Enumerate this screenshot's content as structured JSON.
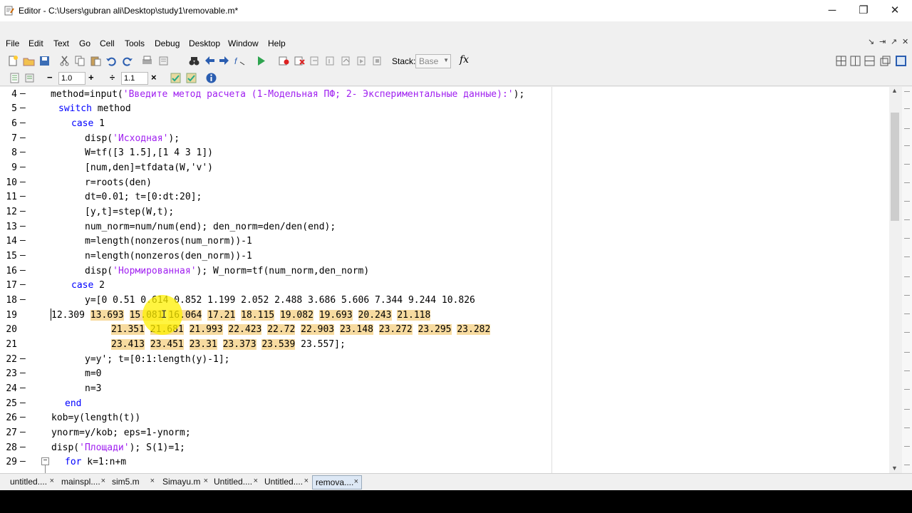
{
  "window": {
    "title": "Editor - C:\\Users\\gubran ali\\Desktop\\study1\\removable.m*",
    "minimize": "─",
    "restore": "❐",
    "close": "✕"
  },
  "menu": [
    "File",
    "Edit",
    "Text",
    "Go",
    "Cell",
    "Tools",
    "Debug",
    "Desktop",
    "Window",
    "Help"
  ],
  "menu_right": [
    "↘",
    "⇥",
    "↗",
    "✕"
  ],
  "toolbar": {
    "stack_label": "Stack:",
    "stack_value": "Base",
    "fx_label": "fx"
  },
  "cell_toolbar": {
    "minus": "−",
    "value1": "1.0",
    "plus": "+",
    "divide": "÷",
    "value2": "1.1",
    "times": "×"
  },
  "editor": {
    "lines": [
      {
        "n": "4",
        "dash": "–",
        "text": "method=input('Введите метод расчета (1-Модельная ПФ; 2- Экспериментальные данные):');"
      },
      {
        "n": "5",
        "dash": "–",
        "kw": "switch",
        "rest": " method"
      },
      {
        "n": "6",
        "dash": "–",
        "kw": "case",
        "rest": " 1"
      },
      {
        "n": "7",
        "dash": "–",
        "pre": "disp(",
        "str": "'Исходная'",
        "post": ");"
      },
      {
        "n": "8",
        "dash": "–",
        "text": "W=tf([3 1.5],[1 4 3 1])"
      },
      {
        "n": "9",
        "dash": "–",
        "text": "[num,den]=tfdata(W,'v')"
      },
      {
        "n": "10",
        "dash": "–",
        "text": "r=roots(den)"
      },
      {
        "n": "11",
        "dash": "–",
        "text": "dt=0.01; t=[0:dt:20];"
      },
      {
        "n": "12",
        "dash": "–",
        "text": "[y,t]=step(W,t);"
      },
      {
        "n": "13",
        "dash": "–",
        "text": "num_norm=num/num(end); den_norm=den/den(end);"
      },
      {
        "n": "14",
        "dash": "–",
        "text": "m=length(nonzeros(num_norm))-1"
      },
      {
        "n": "15",
        "dash": "–",
        "text": "n=length(nonzeros(den_norm))-1"
      },
      {
        "n": "16",
        "dash": "–",
        "pre": "disp(",
        "str": "'Нормированная'",
        "post": "); W_norm=tf(num_norm,den_norm)"
      },
      {
        "n": "17",
        "dash": "–",
        "kw": "case",
        "rest": " 2"
      },
      {
        "n": "18",
        "dash": "–",
        "text": "y=[0 0.51 0.614 0.852 1.199 2.052 2.488 3.686 5.606 7.344 9.244 10.826"
      },
      {
        "n": "19",
        "dash": "",
        "first": "12.309",
        "tokens": [
          "13.693",
          "15.081",
          "16.064",
          "17.21",
          "18.115",
          "19.082",
          "19.693",
          "20.243",
          "21.118"
        ]
      },
      {
        "n": "20",
        "dash": "",
        "tokens": [
          "21.351",
          "21.681",
          "21.993",
          "22.423",
          "22.72",
          "22.903",
          "23.148",
          "23.272",
          "23.295",
          "23.282"
        ]
      },
      {
        "n": "21",
        "dash": "",
        "tokens": [
          "23.413",
          "23.451",
          "23.31",
          "23.373",
          "23.539"
        ],
        "tail": "23.557];"
      },
      {
        "n": "22",
        "dash": "–",
        "text": "y=y'; t=[0:1:length(y)-1];"
      },
      {
        "n": "23",
        "dash": "–",
        "text": "m=0"
      },
      {
        "n": "24",
        "dash": "–",
        "text": "n=3"
      },
      {
        "n": "25",
        "dash": "–",
        "kw": "end",
        "rest": ""
      },
      {
        "n": "26",
        "dash": "–",
        "text": "kob=y(length(t))"
      },
      {
        "n": "27",
        "dash": "–",
        "text": "ynorm=y/kob; eps=1-ynorm;"
      },
      {
        "n": "28",
        "dash": "–",
        "pre": "disp(",
        "str": "'Площади'",
        "post": "); S(1)=1;"
      },
      {
        "n": "29",
        "dash": "–",
        "kw": "for",
        "rest": " k=1:n+m"
      }
    ]
  },
  "tabs": [
    {
      "label": "untitled....",
      "active": false
    },
    {
      "label": "mainspl....",
      "active": false
    },
    {
      "label": "sim5.m",
      "active": false
    },
    {
      "label": "Simayu.m",
      "active": false
    },
    {
      "label": "Untitled....",
      "active": false
    },
    {
      "label": "Untitled....",
      "active": false
    },
    {
      "label": "remova....",
      "active": true
    }
  ],
  "tab_close": "×",
  "colors": {
    "keyword": "#0000ff",
    "string": "#a020f0",
    "highlight": "#f7dba0",
    "cursor_highlight": "#fff000"
  }
}
